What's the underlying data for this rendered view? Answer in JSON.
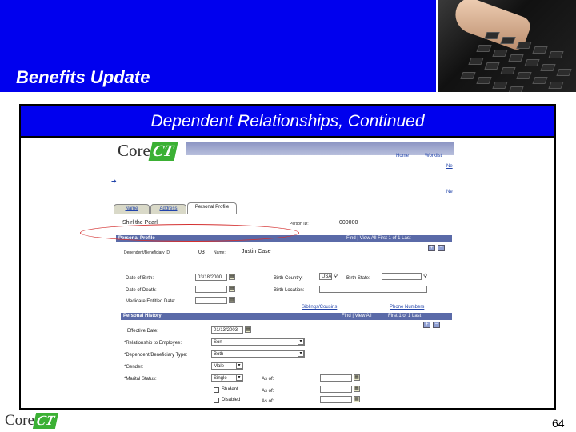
{
  "slide": {
    "title": "Benefits Update",
    "subtitle": "Dependent Relationships, Continued",
    "page_number": "64"
  },
  "logo": {
    "core": "Core",
    "ct": "CT"
  },
  "app": {
    "header_links": [
      "Home",
      "Worklist"
    ],
    "side_link": "Ne",
    "side_link2": "Ne",
    "tabs": [
      {
        "label": "Name",
        "selected": false
      },
      {
        "label": "Address",
        "selected": false
      },
      {
        "label": "Personal Profile",
        "selected": true
      }
    ],
    "employee_name": "Shirl the Pearl",
    "person_id_label": "Person ID:",
    "person_id": "000000",
    "personal_profile": {
      "section_title": "Personal Profile",
      "nav": "Find | View All   First  1 of 1  Last",
      "dep_id_label": "Dependent/Beneficiary ID:",
      "dep_id": "03",
      "name_label": "Name:",
      "name_value": "Justin Case",
      "date_of_birth_label": "Date of Birth:",
      "date_of_birth": "03/18/2000",
      "date_of_death_label": "Date of Death:",
      "date_of_death": "",
      "medicare_label": "Medicare Entitled Date:",
      "medicare_date": "",
      "birth_country_label": "Birth Country:",
      "birth_country": "USA",
      "birth_state_label": "Birth State:",
      "birth_state": "",
      "birth_location_label": "Birth Location:",
      "siblings_link": "Siblings/Cousins",
      "phone_link": "Phone Numbers"
    },
    "personal_history": {
      "section_title": "Personal History",
      "nav": "Find | View All",
      "nav_right": "First  1 of 1  Last",
      "effective_date_label": "Effective Date:",
      "effective_date": "01/13/2003",
      "relationship_label": "*Relationship to Employee:",
      "relationship": "Son",
      "dep_type_label": "*Dependent/Beneficiary Type:",
      "dep_type": "Both",
      "gender_label": "*Gender:",
      "gender": "Male",
      "marital_label": "*Marital Status:",
      "marital": "Single",
      "as_of_label": "As of:",
      "student_label": "Student",
      "disabled_label": "Disabled",
      "student_checked": false,
      "disabled_checked": false
    }
  },
  "colors": {
    "slide_blue": "#0000ee",
    "highlight_oval": "#d43030",
    "logo_green": "#3bb034",
    "section_bar": "#5a6aa8"
  },
  "icons": [
    "calendar-icon",
    "dropdown-arrow-icon",
    "lookup-icon",
    "add-row-icon",
    "delete-row-icon",
    "arrow-icon"
  ]
}
